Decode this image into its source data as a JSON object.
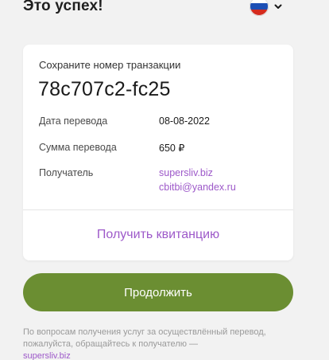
{
  "header": {
    "title": "Это успех!",
    "language_flag": "russia-flag-icon",
    "dropdown_icon": "chevron-down-icon"
  },
  "card": {
    "caption": "Сохраните номер транзакции",
    "transaction_id": "78c707c2-fc25",
    "rows": {
      "date_label": "Дата перевода",
      "date_value": "08-08-2022",
      "amount_label": "Сумма перевода",
      "amount_value": "650 ₽",
      "recipient_label": "Получатель",
      "recipient_site": "supersliv.biz",
      "recipient_email": "cbitbi@yandex.ru"
    },
    "receipt_link": "Получить квитанцию"
  },
  "continue_button": "Продолжить",
  "footnote": {
    "text": "По вопросам получения услуг за осуществлённый перевод, пожалуйста, обращайтесь к получателю —",
    "link": "supersliv.biz"
  },
  "colors": {
    "accent_purple": "#9d59c9",
    "button_green": "#6b8e32",
    "background": "#f2f2f2"
  }
}
